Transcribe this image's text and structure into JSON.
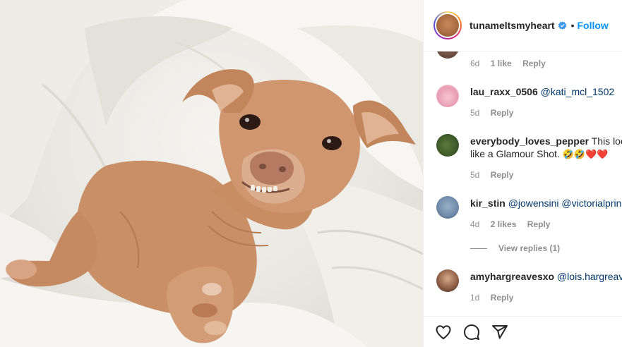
{
  "header": {
    "username": "tunameltsmyheart",
    "separator": "•",
    "follow_label": "Follow"
  },
  "comments": [
    {
      "username": "",
      "text": "",
      "time": "6d",
      "likes": "1 like",
      "reply": "Reply"
    },
    {
      "username": "lau_raxx_0506",
      "text": "@kati_mcl_1502",
      "time": "5d",
      "reply": "Reply"
    },
    {
      "username": "everybody_loves_pepper",
      "text": "This looks like a Glamour Shot.",
      "emoji": "🤣🤣❤️❤️",
      "time": "5d",
      "reply": "Reply"
    },
    {
      "username": "kir_stin",
      "text": "@jowensini @victorialprince",
      "time": "4d",
      "likes": "2 likes",
      "reply": "Reply",
      "view_replies": "View replies (1)"
    },
    {
      "username": "amyhargreavesxo",
      "text": "@lois.hargreaves",
      "time": "1d",
      "reply": "Reply"
    }
  ],
  "icons": {
    "verified": "verified-badge-icon",
    "like": "heart-icon",
    "comment": "comment-bubble-icon",
    "share": "paper-plane-icon"
  },
  "colors": {
    "link": "#0095f6",
    "mention": "#00376b",
    "muted": "#8e8e8e",
    "text": "#262626"
  }
}
